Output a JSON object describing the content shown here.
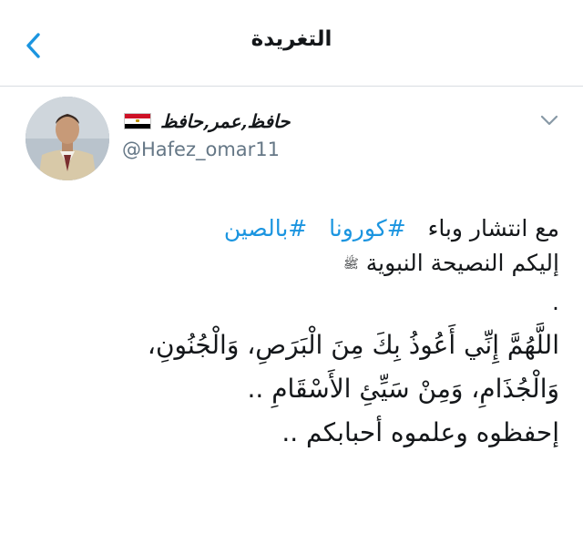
{
  "header": {
    "title": "التغريدة",
    "back_icon": "chevron-left-icon",
    "accent_color": "#1b95e0"
  },
  "tweet": {
    "author": {
      "display_name": "حافظ,عمر,حافظ",
      "flag": "egypt-flag-icon",
      "username": "@Hafez_omar11"
    },
    "menu_icon": "chevron-down-icon",
    "lines": {
      "line1_text": "مع انتشار وباء",
      "hashtag1": "#كورونا",
      "hashtag2": "#بالصين",
      "line2_text": "إليكم النصيحة النبوية",
      "line2_honorific": "ﷺ",
      "line3_dot": ".",
      "line4": "اللَّهُمَّ إِنِّي أَعُوذُ بِكَ مِنَ الْبَرَصِ، وَالْجُنُونِ،",
      "line5": "وَالْجُذَامِ، وَمِنْ سَيِّئِ الأَسْقَامِ ..",
      "line6": "إحفظوه وعلموه أحبابكم .."
    }
  }
}
